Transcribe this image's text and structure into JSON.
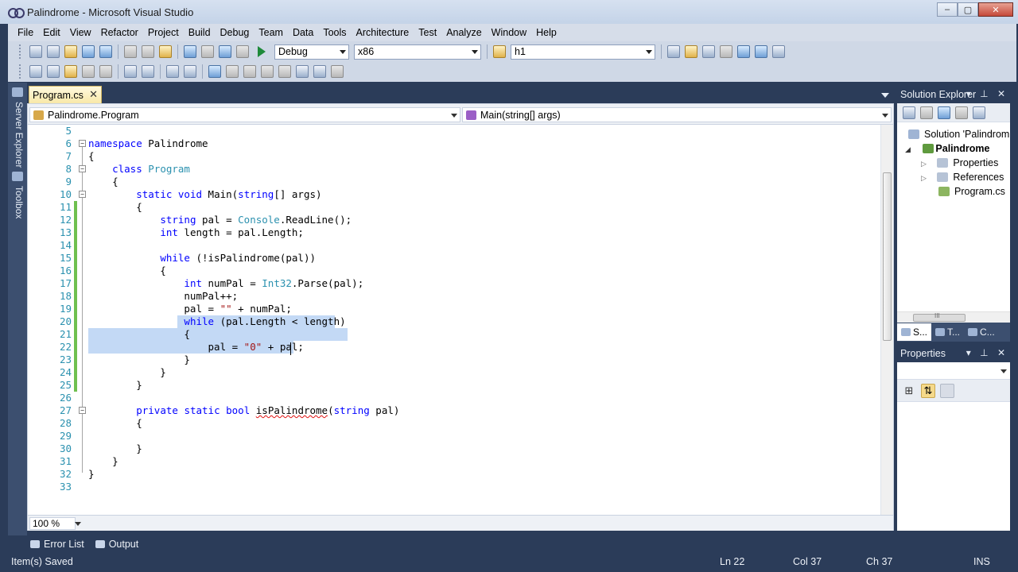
{
  "window": {
    "title": "Palindrome - Microsoft Visual Studio",
    "minimize": "–",
    "maximize": "▢",
    "close": "✕"
  },
  "menu": [
    "File",
    "Edit",
    "View",
    "Refactor",
    "Project",
    "Build",
    "Debug",
    "Team",
    "Data",
    "Tools",
    "Architecture",
    "Test",
    "Analyze",
    "Window",
    "Help"
  ],
  "toolbar": {
    "config": "Debug",
    "platform": "x86",
    "find": "h1"
  },
  "left_dock": {
    "server_explorer": "Server Explorer",
    "toolbox": "Toolbox"
  },
  "document_tab": {
    "label": "Program.cs",
    "close": "✕"
  },
  "nav": {
    "type_combo": "Palindrome.Program",
    "member_combo": "Main(string[] args)"
  },
  "code_lines": [
    {
      "n": "5",
      "text": ""
    },
    {
      "n": "6",
      "text": "namespace Palindrome"
    },
    {
      "n": "7",
      "text": "{"
    },
    {
      "n": "8",
      "text": "    class Program"
    },
    {
      "n": "9",
      "text": "    {"
    },
    {
      "n": "10",
      "text": "        static void Main(string[] args)"
    },
    {
      "n": "11",
      "text": "        {"
    },
    {
      "n": "12",
      "text": "            string pal = Console.ReadLine();"
    },
    {
      "n": "13",
      "text": "            int length = pal.Length;"
    },
    {
      "n": "14",
      "text": ""
    },
    {
      "n": "15",
      "text": "            while (!isPalindrome(pal))"
    },
    {
      "n": "16",
      "text": "            {"
    },
    {
      "n": "17",
      "text": "                int numPal = Int32.Parse(pal);"
    },
    {
      "n": "18",
      "text": "                numPal++;"
    },
    {
      "n": "19",
      "text": "                pal = \"\" + numPal;"
    },
    {
      "n": "20",
      "text": "                while (pal.Length < length)"
    },
    {
      "n": "21",
      "text": "                {"
    },
    {
      "n": "22",
      "text": "                    pal = \"0\" + pal;"
    },
    {
      "n": "23",
      "text": "                }"
    },
    {
      "n": "24",
      "text": "            }"
    },
    {
      "n": "25",
      "text": "        }"
    },
    {
      "n": "26",
      "text": ""
    },
    {
      "n": "27",
      "text": "        private static bool isPalindrome(string pal)"
    },
    {
      "n": "28",
      "text": "        {"
    },
    {
      "n": "29",
      "text": ""
    },
    {
      "n": "30",
      "text": "        }"
    },
    {
      "n": "31",
      "text": "    }"
    },
    {
      "n": "32",
      "text": "}"
    },
    {
      "n": "33",
      "text": ""
    }
  ],
  "zoom": "100 %",
  "solution_explorer": {
    "title": "Solution Explorer",
    "controls": "▾ ⊥ ✕",
    "items": [
      {
        "label": "Solution 'Palindrom"
      },
      {
        "label": "Palindrome"
      },
      {
        "label": "Properties"
      },
      {
        "label": "References"
      },
      {
        "label": "Program.cs"
      }
    ],
    "hscroll_grip": "III",
    "tabs": [
      "S...",
      "T...",
      "C..."
    ]
  },
  "properties": {
    "title": "Properties",
    "controls": "▾ ⊥ ✕",
    "categorized_icon": "⊞",
    "alpha_icon": "⇅"
  },
  "bottom_tabs": [
    "Error List",
    "Output"
  ],
  "status": {
    "message": "Item(s) Saved",
    "ln": "Ln 22",
    "col": "Col 37",
    "ch": "Ch 37",
    "mode": "INS"
  },
  "colors": {
    "keyword": "#0000ff",
    "type": "#2b91af",
    "string": "#a31515",
    "selection": "#c3d9f5",
    "chrome": "#2b3c59"
  }
}
